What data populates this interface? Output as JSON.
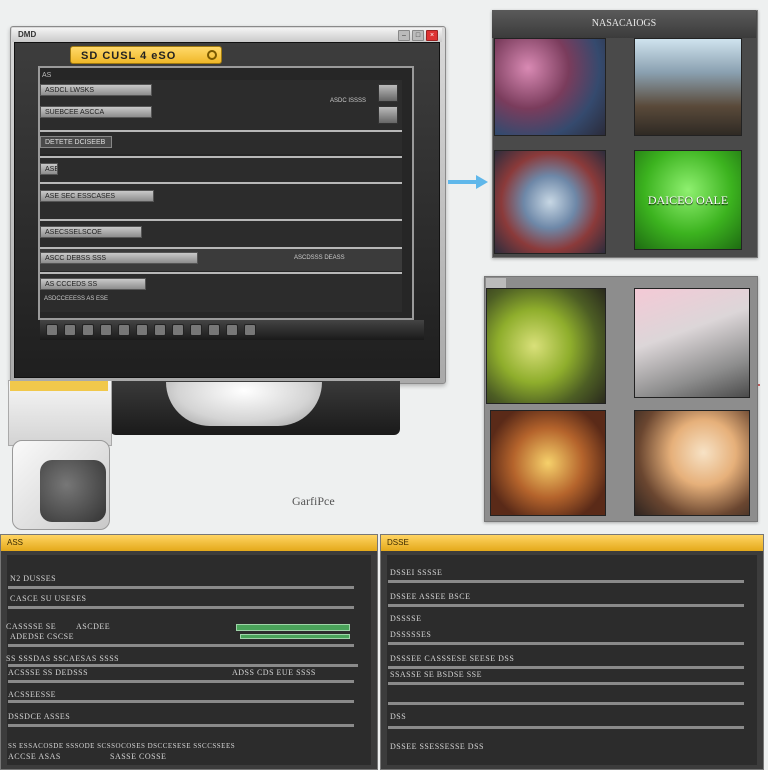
{
  "window": {
    "title": "DMD",
    "tab_label": "SD CUSL 4 eSO",
    "close_glyph": "×",
    "screen_label": "AS",
    "rows": [
      {
        "chip": "ASDCL LWSKS",
        "text": "ASDC ISSSS"
      },
      {
        "chip": "SUEBCEE ASCCA",
        "text": ""
      },
      {
        "chip": "DETETE DCISEEB",
        "text": ""
      },
      {
        "chip": "ASEO",
        "text": ""
      },
      {
        "chip": "ASE SEC ESSCASES",
        "text": ""
      },
      {
        "chip": "ASECSSELSCOE",
        "text": ""
      },
      {
        "chip": "ASCC DEBSS SSS",
        "text": "ASCDSSS DEASS"
      },
      {
        "chip": "AS CCCEDS SS",
        "text": "ASDCCEEESS AS ESE"
      }
    ]
  },
  "caption": "GarfiPce",
  "gallery_top": {
    "title": "NASACAIOGS",
    "green_thumb_text": "DAICEO OALE"
  },
  "bottom_left": {
    "header": "ASS",
    "lines": [
      "N2 DUSSES",
      "CASCE SU USESES",
      "CASSSSE SE",
      "ASCDEE",
      "SS SSSDAS SSCAESAS SSSS",
      "ACSSSE SS DEDSSS",
      "ADEDSE CSCSE",
      "DSSDCE ASSES",
      "ACSSEESSE",
      "ADSS CDS EUE SSSS",
      "ACCSE ASAS",
      "SASSE COSSE",
      "SS ESSACOSDE SSSODE SCSSOCOSES DSCCESESE SSCCSSEES"
    ]
  },
  "bottom_right": {
    "header": "DSSE",
    "lines": [
      "DSSEI SSSSE",
      "DSSEE ASSEE BSCE",
      "DSSSSE",
      "DSSSSSES",
      "DSSSEE CASSSESE SEESE DSS",
      "SSASSE SE BSDSE SSE",
      "DSS",
      "DSSEE SSESSESSE DSS"
    ]
  }
}
